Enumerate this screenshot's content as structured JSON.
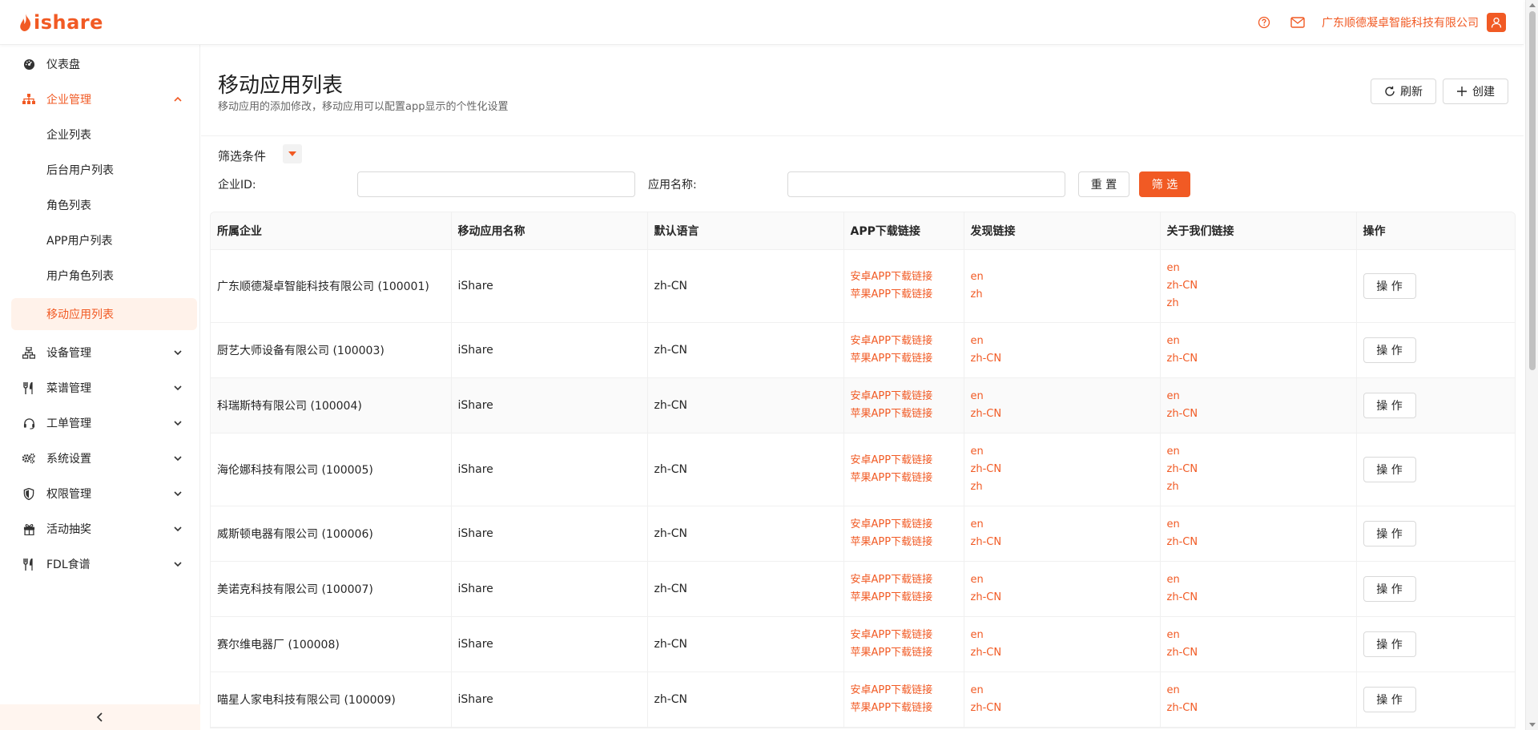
{
  "brand": {
    "logo_text": "ishare",
    "accent": "#f15a24"
  },
  "header": {
    "company_name": "广东顺德凝卓智能科技有限公司",
    "help_icon": "question-circle-icon",
    "mail_icon": "mail-icon",
    "user_icon": "user-icon"
  },
  "sidebar": {
    "dashboard": "仪表盘",
    "enterprise_group": "企业管理",
    "enterprise_items": [
      "企业列表",
      "后台用户列表",
      "角色列表",
      "APP用户列表",
      "用户角色列表",
      "移动应用列表"
    ],
    "active_item": "移动应用列表",
    "groups": [
      "设备管理",
      "菜谱管理",
      "工单管理",
      "系统设置",
      "权限管理",
      "活动抽奖",
      "FDL食谱"
    ]
  },
  "page": {
    "title": "移动应用列表",
    "description": "移动应用的添加修改，移动应用可以配置app显示的个性化设置",
    "refresh_label": "刷新",
    "create_label": "创建"
  },
  "filter": {
    "title": "筛选条件",
    "enterprise_id_label": "企业ID:",
    "enterprise_id_value": "",
    "app_name_label": "应用名称:",
    "app_name_value": "",
    "reset_label": "重 置",
    "submit_label": "筛 选"
  },
  "table": {
    "columns": [
      "所属企业",
      "移动应用名称",
      "默认语言",
      "APP下载链接",
      "发现链接",
      "关于我们链接",
      "操作"
    ],
    "rows": [
      {
        "company": "广东顺德凝卓智能科技有限公司 (100001)",
        "app": "iShare",
        "lang": "zh-CN",
        "android": "安卓APP下载链接",
        "ios": "苹果APP下载链接",
        "discover": [
          "en",
          "zh"
        ],
        "about": [
          "en",
          "zh-CN",
          "zh"
        ],
        "action": "操 作"
      },
      {
        "company": "厨艺大师设备有限公司 (100003)",
        "app": "iShare",
        "lang": "zh-CN",
        "android": "安卓APP下载链接",
        "ios": "苹果APP下载链接",
        "discover": [
          "en",
          "zh-CN"
        ],
        "about": [
          "en",
          "zh-CN"
        ],
        "action": "操 作"
      },
      {
        "company": "科瑞斯特有限公司 (100004)",
        "app": "iShare",
        "lang": "zh-CN",
        "android": "安卓APP下载链接",
        "ios": "苹果APP下载链接",
        "discover": [
          "en",
          "zh-CN"
        ],
        "about": [
          "en",
          "zh-CN"
        ],
        "action": "操 作"
      },
      {
        "company": "海伦娜科技有限公司 (100005)",
        "app": "iShare",
        "lang": "zh-CN",
        "android": "安卓APP下载链接",
        "ios": "苹果APP下载链接",
        "discover": [
          "en",
          "zh-CN",
          "zh"
        ],
        "about": [
          "en",
          "zh-CN",
          "zh"
        ],
        "action": "操 作"
      },
      {
        "company": "威斯顿电器有限公司 (100006)",
        "app": "iShare",
        "lang": "zh-CN",
        "android": "安卓APP下载链接",
        "ios": "苹果APP下载链接",
        "discover": [
          "en",
          "zh-CN"
        ],
        "about": [
          "en",
          "zh-CN"
        ],
        "action": "操 作"
      },
      {
        "company": "美诺克科技有限公司 (100007)",
        "app": "iShare",
        "lang": "zh-CN",
        "android": "安卓APP下载链接",
        "ios": "苹果APP下载链接",
        "discover": [
          "en",
          "zh-CN"
        ],
        "about": [
          "en",
          "zh-CN"
        ],
        "action": "操 作"
      },
      {
        "company": "赛尔维电器厂 (100008)",
        "app": "iShare",
        "lang": "zh-CN",
        "android": "安卓APP下载链接",
        "ios": "苹果APP下载链接",
        "discover": [
          "en",
          "zh-CN"
        ],
        "about": [
          "en",
          "zh-CN"
        ],
        "action": "操 作"
      },
      {
        "company": "喵星人家电科技有限公司 (100009)",
        "app": "iShare",
        "lang": "zh-CN",
        "android": "安卓APP下载链接",
        "ios": "苹果APP下载链接",
        "discover": [
          "en",
          "zh-CN"
        ],
        "about": [
          "en",
          "zh-CN"
        ],
        "action": "操 作"
      }
    ]
  }
}
